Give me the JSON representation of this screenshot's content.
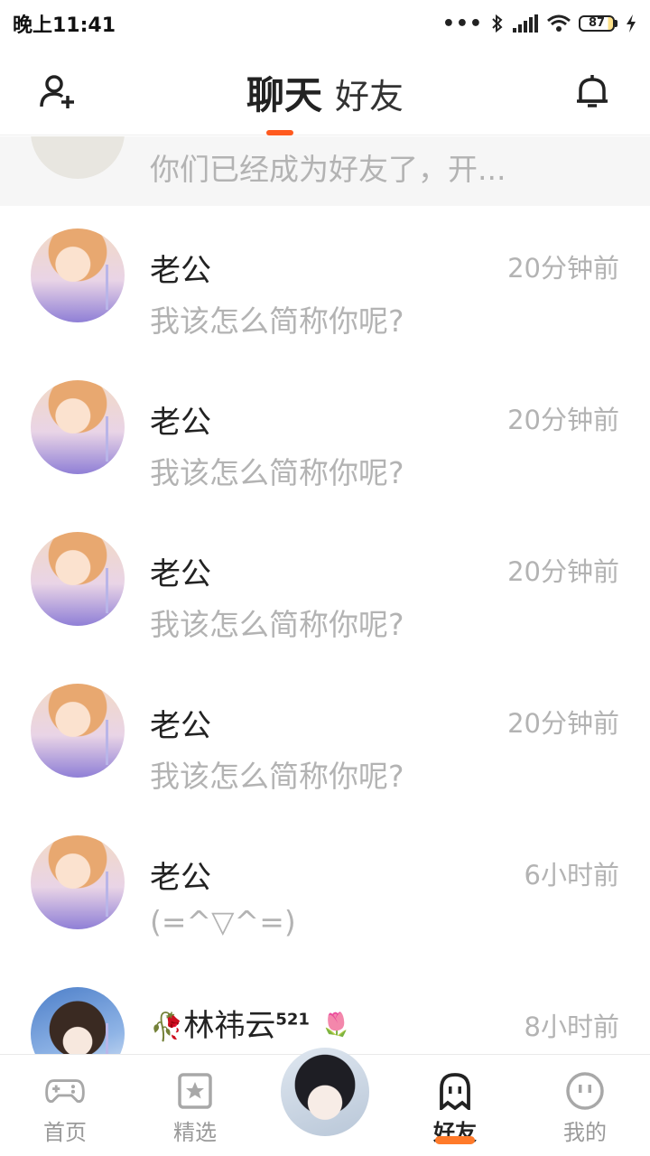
{
  "status_bar": {
    "time": "晚上11:41",
    "dots": "•••",
    "battery": "87"
  },
  "header": {
    "tab_active": "聊天",
    "tab_other": "好友"
  },
  "highlight": {
    "message": "你们已经成为好友了，开..."
  },
  "conversations": [
    {
      "name": "老公",
      "time": "20分钟前",
      "message": "我该怎么简称你呢?"
    },
    {
      "name": "老公",
      "time": "20分钟前",
      "message": "我该怎么简称你呢?"
    },
    {
      "name": "老公",
      "time": "20分钟前",
      "message": "我该怎么简称你呢?"
    },
    {
      "name": "老公",
      "time": "20分钟前",
      "message": "我该怎么简称你呢?"
    },
    {
      "name": "老公",
      "time": "6小时前",
      "message": "(=^▽^=)"
    },
    {
      "name": "林祎云",
      "name_sup": "521",
      "name_prefix": "🥀",
      "name_suffix": "🌷",
      "time": "8小时前"
    }
  ],
  "bottom_nav": {
    "home": "首页",
    "featured": "精选",
    "friends": "好友",
    "mine": "我的"
  },
  "colors": {
    "accent": "#ff5a1f",
    "muted_text": "#b3b3b3"
  }
}
